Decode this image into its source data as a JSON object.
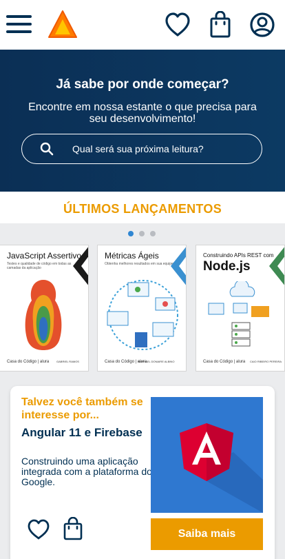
{
  "header": {
    "menu_icon": "hamburger-icon",
    "logo_icon": "triangle-logo-icon",
    "favorites_icon": "heart-icon",
    "bag_icon": "shopping-bag-icon",
    "profile_icon": "user-circle-icon"
  },
  "hero": {
    "title": "Já sabe por onde começar?",
    "subtitle": "Encontre em nossa estante o que precisa para seu desenvolvimento!",
    "search_placeholder": "Qual será sua próxima leitura?",
    "search_icon": "search-icon"
  },
  "releases": {
    "title": "ÚLTIMOS LANÇAMENTOS",
    "carousel_pages": 3,
    "active_page": 1,
    "books": [
      {
        "title": "JavaScript Assertivo",
        "subtitle": "Testes e qualidade de código em todas as camadas da aplicação",
        "publisher": "Casa do Código | alura",
        "author": "GABRIEL RAMOS"
      },
      {
        "title": "Métricas Ágeis",
        "subtitle": "Obtenha melhores resultados em sua equipe",
        "publisher": "Casa do Código | alura",
        "author": "RAPHAEL DONAIRE ALBINO"
      },
      {
        "title": "Construindo APIs REST com",
        "title_big": "Node.js",
        "subtitle": "",
        "publisher": "Casa do Código | alura",
        "author": "CAIO RIBEIRO PEREIRA"
      }
    ]
  },
  "suggestion": {
    "kicker": "Talvez você também se interesse por...",
    "title": "Angular 11 e Firebase",
    "description": "Construindo uma aplicação integrada com a plataforma do Google.",
    "cover_icon": "angular-logo-icon",
    "favorite_icon": "heart-icon",
    "bag_icon": "shopping-bag-icon",
    "cta_label": "Saiba mais"
  },
  "colors": {
    "accent": "#eb9b00",
    "navy": "#002f52",
    "hero_bg": "#0c3a63",
    "angular_red": "#dd0031",
    "cover_blue": "#2f78d0"
  }
}
